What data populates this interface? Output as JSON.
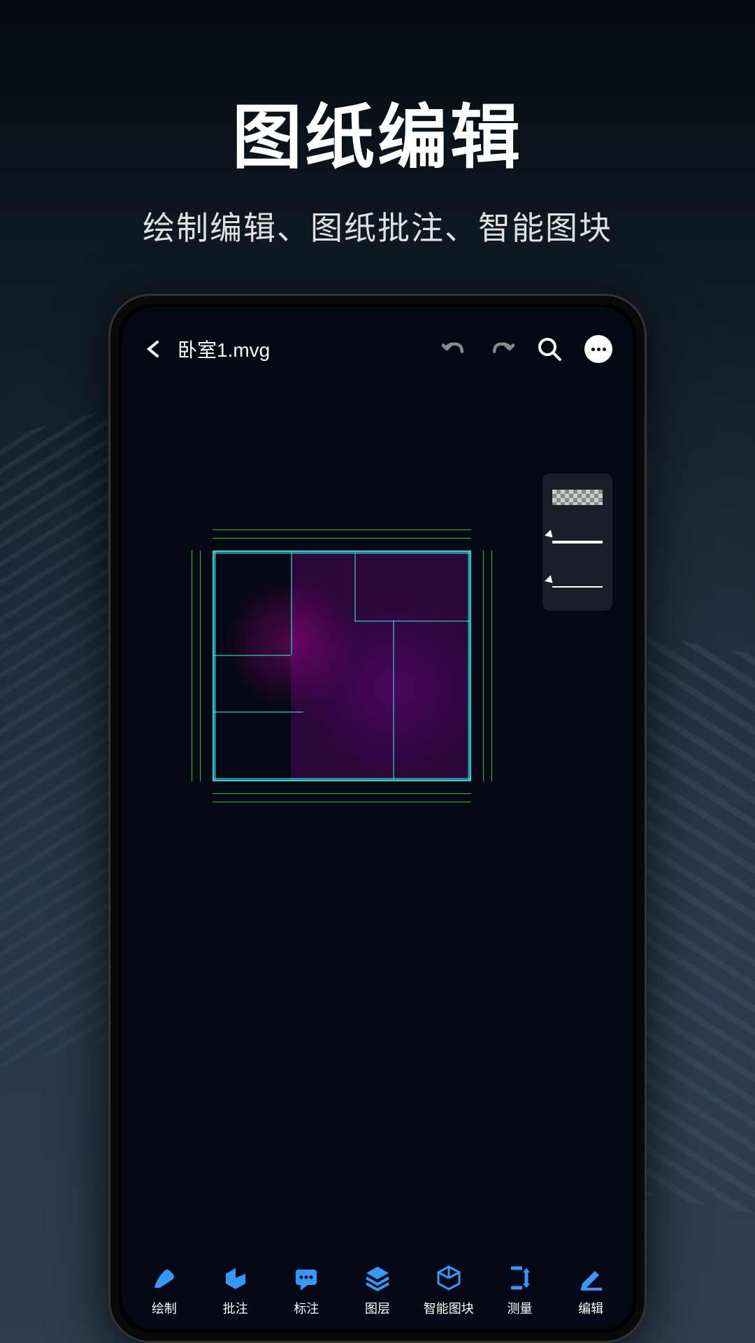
{
  "header": {
    "title": "图纸编辑",
    "subtitle": "绘制编辑、图纸批注、智能图块"
  },
  "app": {
    "filename": "卧室1.mvg"
  },
  "palette": {
    "items": [
      "texture",
      "line-medium",
      "line-thin"
    ]
  },
  "toolbar": {
    "items": [
      {
        "icon": "pen",
        "label": "绘制"
      },
      {
        "icon": "tag",
        "label": "批注"
      },
      {
        "icon": "comment",
        "label": "标注"
      },
      {
        "icon": "layers",
        "label": "图层"
      },
      {
        "icon": "cube",
        "label": "智能图块"
      },
      {
        "icon": "measure",
        "label": "测量"
      },
      {
        "icon": "edit",
        "label": "编辑"
      }
    ]
  },
  "colors": {
    "accent": "#3399ff",
    "canvas_outline": "#30d0d0",
    "dimension": "#00cc44",
    "floorplan_fill": "#cc00cc"
  }
}
